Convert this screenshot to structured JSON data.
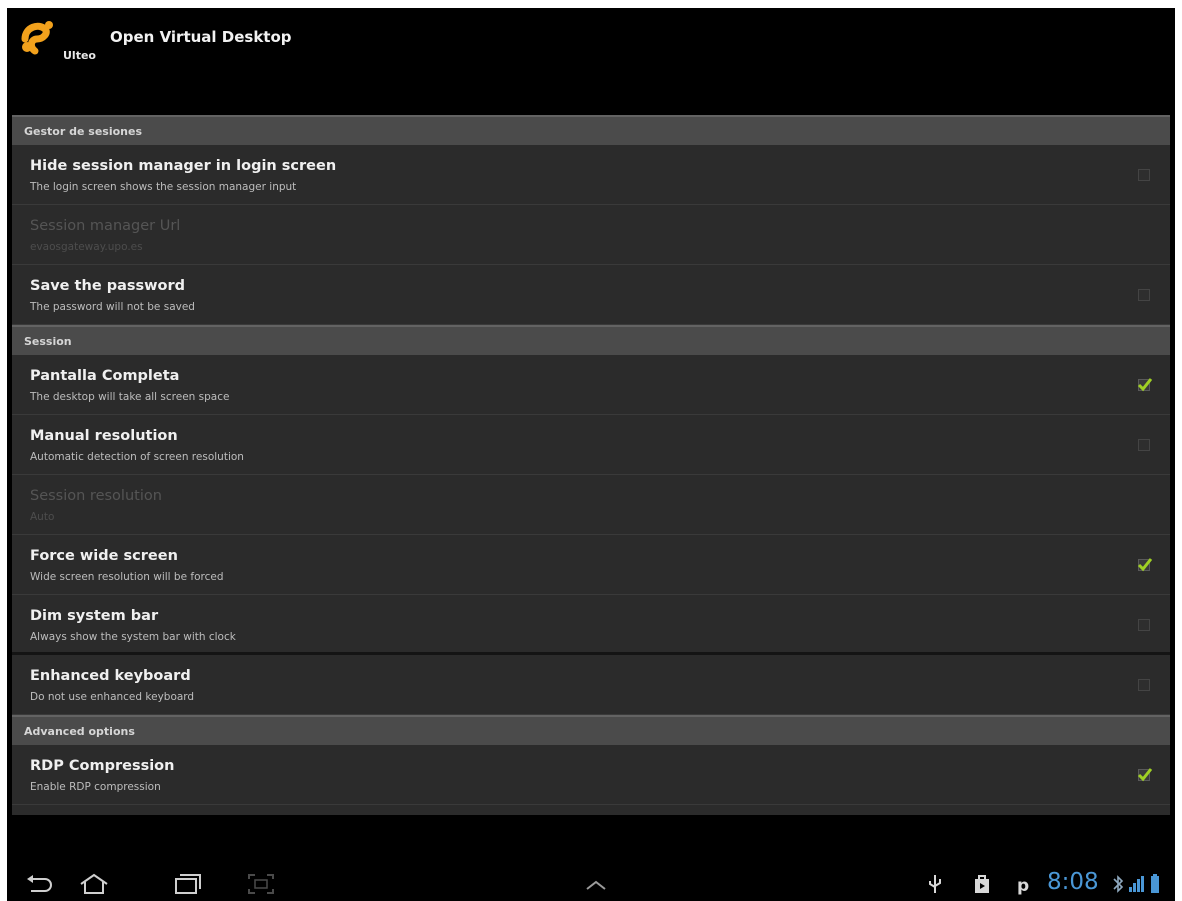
{
  "app": {
    "title": "Open Virtual Desktop",
    "logo_text": "Ulteo"
  },
  "sections": [
    {
      "header": "Gestor de sesiones",
      "items": [
        {
          "title": "Hide session manager in login screen",
          "summary": "The login screen shows the session manager input",
          "checkbox": true,
          "checked": false,
          "enabled": true
        },
        {
          "title": "Session manager Url",
          "summary": "evaosgateway.upo.es",
          "checkbox": false,
          "enabled": false
        },
        {
          "title": "Save the password",
          "summary": "The password will not be saved",
          "checkbox": true,
          "checked": false,
          "enabled": true
        }
      ]
    },
    {
      "header": "Session",
      "items": [
        {
          "title": "Pantalla Completa",
          "summary": "The desktop will take all screen space",
          "checkbox": true,
          "checked": true,
          "enabled": true
        },
        {
          "title": "Manual resolution",
          "summary": "Automatic detection of screen resolution",
          "checkbox": true,
          "checked": false,
          "enabled": true
        },
        {
          "title": "Session resolution",
          "summary": "Auto",
          "checkbox": false,
          "enabled": false
        },
        {
          "title": "Force wide screen",
          "summary": "Wide screen resolution will be forced",
          "checkbox": true,
          "checked": true,
          "enabled": true
        },
        {
          "title": "Dim system bar",
          "summary": "Always show the system bar with clock",
          "checkbox": true,
          "checked": false,
          "enabled": true
        },
        {
          "title": "Enhanced keyboard",
          "summary": "Do not use enhanced keyboard",
          "checkbox": true,
          "checked": false,
          "enabled": true
        }
      ]
    },
    {
      "header": "Advanced options",
      "items": [
        {
          "title": "RDP Compression",
          "summary": "Enable RDP compression",
          "checkbox": true,
          "checked": true,
          "enabled": true
        }
      ]
    }
  ],
  "system_bar": {
    "clock": "8:08",
    "icons": [
      "back-icon",
      "home-icon",
      "recent-apps-icon",
      "screenshot-icon",
      "menu-up-icon",
      "usb-icon",
      "store-icon",
      "p-icon",
      "bluetooth-icon",
      "signal-3g-icon",
      "battery-icon"
    ]
  },
  "colors": {
    "accent_check": "#9fd024",
    "clock": "#4a97d6",
    "section_header": "#4b4b4b",
    "list_bg": "#2b2b2b"
  }
}
